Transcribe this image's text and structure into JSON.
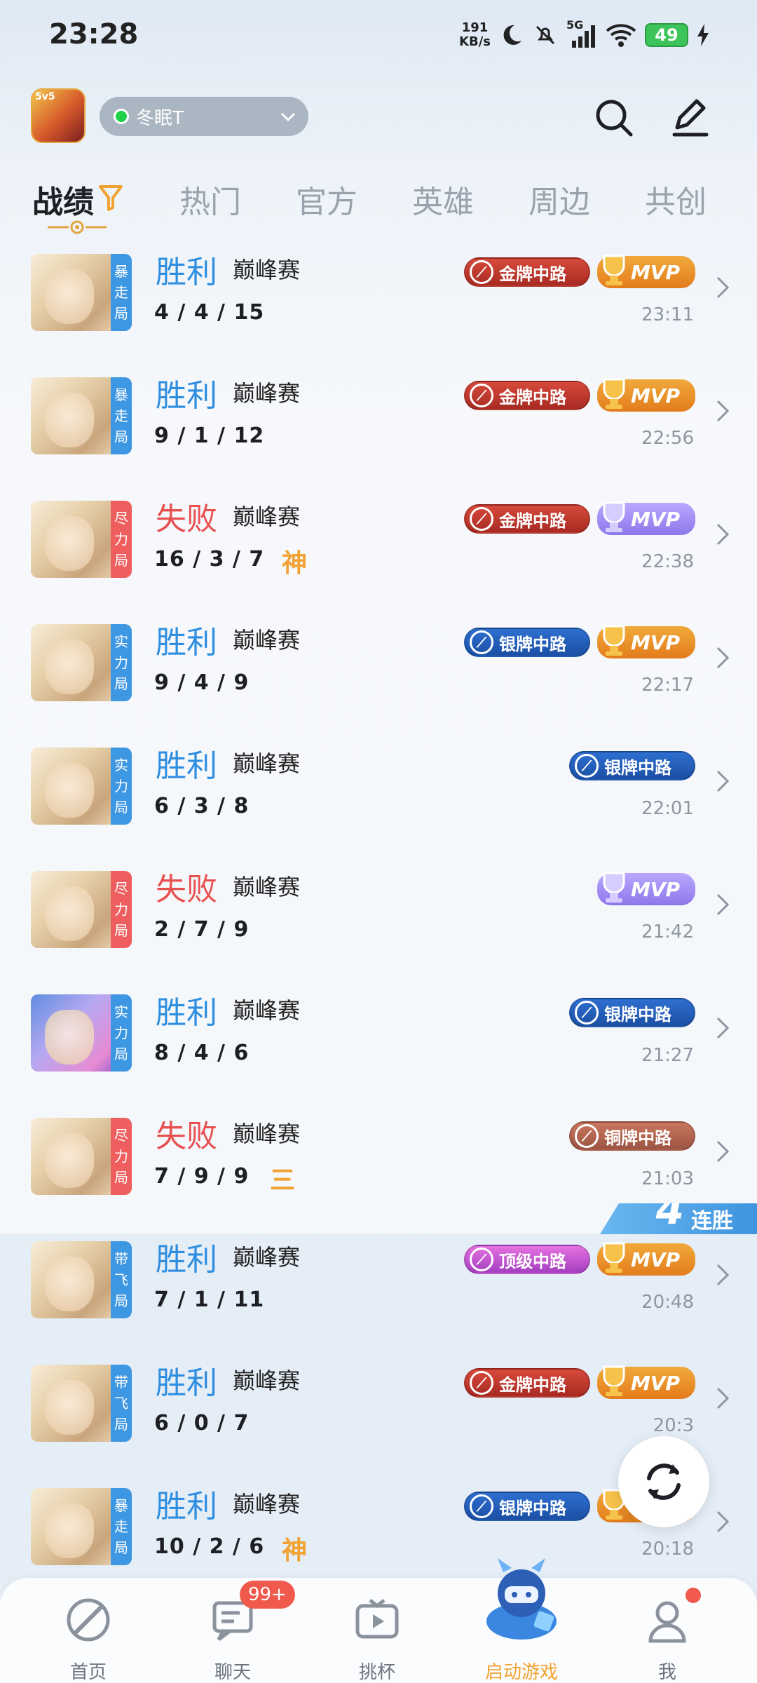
{
  "status_bar": {
    "time": "23:28",
    "net_speed": "191",
    "net_unit": "KB/s",
    "signal": "5G",
    "battery": "49"
  },
  "header": {
    "account_name": "冬眠T",
    "icons": [
      "app-logo-icon",
      "search-icon",
      "edit-icon"
    ]
  },
  "tabs": [
    {
      "label": "战绩",
      "active": true
    },
    {
      "label": "热门"
    },
    {
      "label": "官方"
    },
    {
      "label": "英雄"
    },
    {
      "label": "周边"
    },
    {
      "label": "共创"
    }
  ],
  "matches": [
    {
      "result": "胜利",
      "result_type": "win",
      "mode": "巅峰赛",
      "kda": "4 / 4 / 15",
      "tag": "",
      "badge_mode": [
        "暴",
        "走",
        "局"
      ],
      "badge_color": "blue",
      "lane": "金牌中路",
      "lane_type": "gold",
      "mvp": "MVP",
      "mvp_type": "gold",
      "time": "23:11",
      "avatar": "default"
    },
    {
      "result": "胜利",
      "result_type": "win",
      "mode": "巅峰赛",
      "kda": "9 / 1 / 12",
      "tag": "",
      "badge_mode": [
        "暴",
        "走",
        "局"
      ],
      "badge_color": "blue",
      "lane": "金牌中路",
      "lane_type": "gold",
      "mvp": "MVP",
      "mvp_type": "gold",
      "time": "22:56",
      "avatar": "default"
    },
    {
      "result": "失败",
      "result_type": "loss",
      "mode": "巅峰赛",
      "kda": "16 / 3 / 7",
      "tag": "神",
      "badge_mode": [
        "尽",
        "力",
        "局"
      ],
      "badge_color": "red",
      "lane": "金牌中路",
      "lane_type": "gold",
      "mvp": "MVP",
      "mvp_type": "purple",
      "time": "22:38",
      "avatar": "default"
    },
    {
      "result": "胜利",
      "result_type": "win",
      "mode": "巅峰赛",
      "kda": "9 / 4 / 9",
      "tag": "",
      "badge_mode": [
        "实",
        "力",
        "局"
      ],
      "badge_color": "blue",
      "lane": "银牌中路",
      "lane_type": "silver",
      "mvp": "MVP",
      "mvp_type": "gold",
      "time": "22:17",
      "avatar": "default"
    },
    {
      "result": "胜利",
      "result_type": "win",
      "mode": "巅峰赛",
      "kda": "6 / 3 / 8",
      "tag": "",
      "badge_mode": [
        "实",
        "力",
        "局"
      ],
      "badge_color": "blue",
      "lane": "银牌中路",
      "lane_type": "silver",
      "mvp": "",
      "mvp_type": "",
      "time": "22:01",
      "avatar": "default"
    },
    {
      "result": "失败",
      "result_type": "loss",
      "mode": "巅峰赛",
      "kda": "2 / 7 / 9",
      "tag": "",
      "badge_mode": [
        "尽",
        "力",
        "局"
      ],
      "badge_color": "red",
      "lane": "",
      "lane_type": "",
      "mvp": "MVP",
      "mvp_type": "purple",
      "time": "21:42",
      "avatar": "default"
    },
    {
      "result": "胜利",
      "result_type": "win",
      "mode": "巅峰赛",
      "kda": "8 / 4 / 6",
      "tag": "",
      "badge_mode": [
        "实",
        "力",
        "局"
      ],
      "badge_color": "blue",
      "lane": "银牌中路",
      "lane_type": "silver",
      "mvp": "",
      "mvp_type": "",
      "time": "21:27",
      "avatar": "alt"
    },
    {
      "result": "失败",
      "result_type": "loss",
      "mode": "巅峰赛",
      "kda": "7 / 9 / 9",
      "tag": "三",
      "badge_mode": [
        "尽",
        "力",
        "局"
      ],
      "badge_color": "red",
      "lane": "铜牌中路",
      "lane_type": "bronze",
      "mvp": "",
      "mvp_type": "",
      "time": "21:03",
      "avatar": "default"
    },
    {
      "result": "胜利",
      "result_type": "win",
      "mode": "巅峰赛",
      "kda": "7 / 1 / 11",
      "tag": "",
      "badge_mode": [
        "带",
        "飞",
        "局"
      ],
      "badge_color": "blue",
      "lane": "顶级中路",
      "lane_type": "top",
      "mvp": "MVP",
      "mvp_type": "gold",
      "time": "20:48",
      "avatar": "default",
      "highlight": true
    },
    {
      "result": "胜利",
      "result_type": "win",
      "mode": "巅峰赛",
      "kda": "6 / 0 / 7",
      "tag": "",
      "badge_mode": [
        "带",
        "飞",
        "局"
      ],
      "badge_color": "blue",
      "lane": "金牌中路",
      "lane_type": "gold",
      "mvp": "MVP",
      "mvp_type": "gold",
      "time": "20:3",
      "avatar": "default",
      "highlight": true
    },
    {
      "result": "胜利",
      "result_type": "win",
      "mode": "巅峰赛",
      "kda": "10 / 2 / 6",
      "tag": "神",
      "badge_mode": [
        "暴",
        "走",
        "局"
      ],
      "badge_color": "blue",
      "lane": "银牌中路",
      "lane_type": "silver",
      "mvp": "MVP",
      "mvp_type": "gold",
      "time": "20:18",
      "avatar": "default",
      "highlight": true
    }
  ],
  "streak": {
    "count": "4",
    "label": "连胜"
  },
  "bottom_nav": [
    {
      "label": "首页",
      "icon": "home-icon"
    },
    {
      "label": "聊天",
      "icon": "chat-icon",
      "badge": "99+"
    },
    {
      "label": "挑杯",
      "icon": "video-icon"
    },
    {
      "label": "启动游戏",
      "icon": "launch-game-icon",
      "active": true
    },
    {
      "label": "我",
      "icon": "profile-icon",
      "dot": true
    }
  ],
  "colors": {
    "win": "#2f8ee0",
    "loss": "#e85050",
    "accent": "#f2a232"
  }
}
